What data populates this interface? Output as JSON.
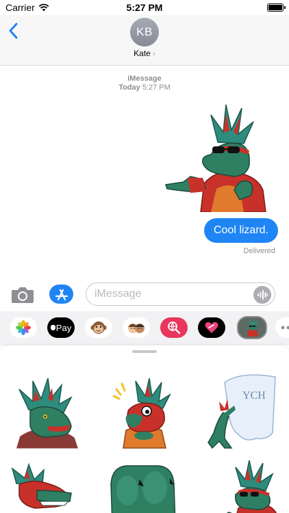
{
  "status_bar": {
    "carrier": "Carrier",
    "time": "5:27 PM"
  },
  "header": {
    "avatar_initials": "KB",
    "contact_name": "Kate",
    "chevron": "›"
  },
  "conversation": {
    "service": "iMessage",
    "timestamp_day": "Today",
    "timestamp_time": "5:27 PM",
    "message_text": "Cool lizard.",
    "delivery_status": "Delivered"
  },
  "input_bar": {
    "placeholder": "iMessage"
  },
  "app_drawer": {
    "apps": [
      "photos-app",
      "apple-pay-app",
      "animoji-app",
      "memoji-app",
      "web-search-app",
      "digital-touch-app",
      "lizard-sticker-app",
      "more-apps"
    ],
    "apple_pay_label": "Pay"
  },
  "sticker_panel": {
    "stickers": [
      "lizard-portrait",
      "lizard-excited",
      "lizard-ych-sign",
      "lizard-wink",
      "lizard-paw",
      "lizard-pointing"
    ],
    "ych_text": "YCH"
  },
  "colors": {
    "accent": "#1f85f5",
    "lizard_green": "#2f7f63",
    "lizard_red": "#c8312a",
    "feather_teal": "#2d8c7d",
    "shirt_orange": "#e07a2c"
  }
}
